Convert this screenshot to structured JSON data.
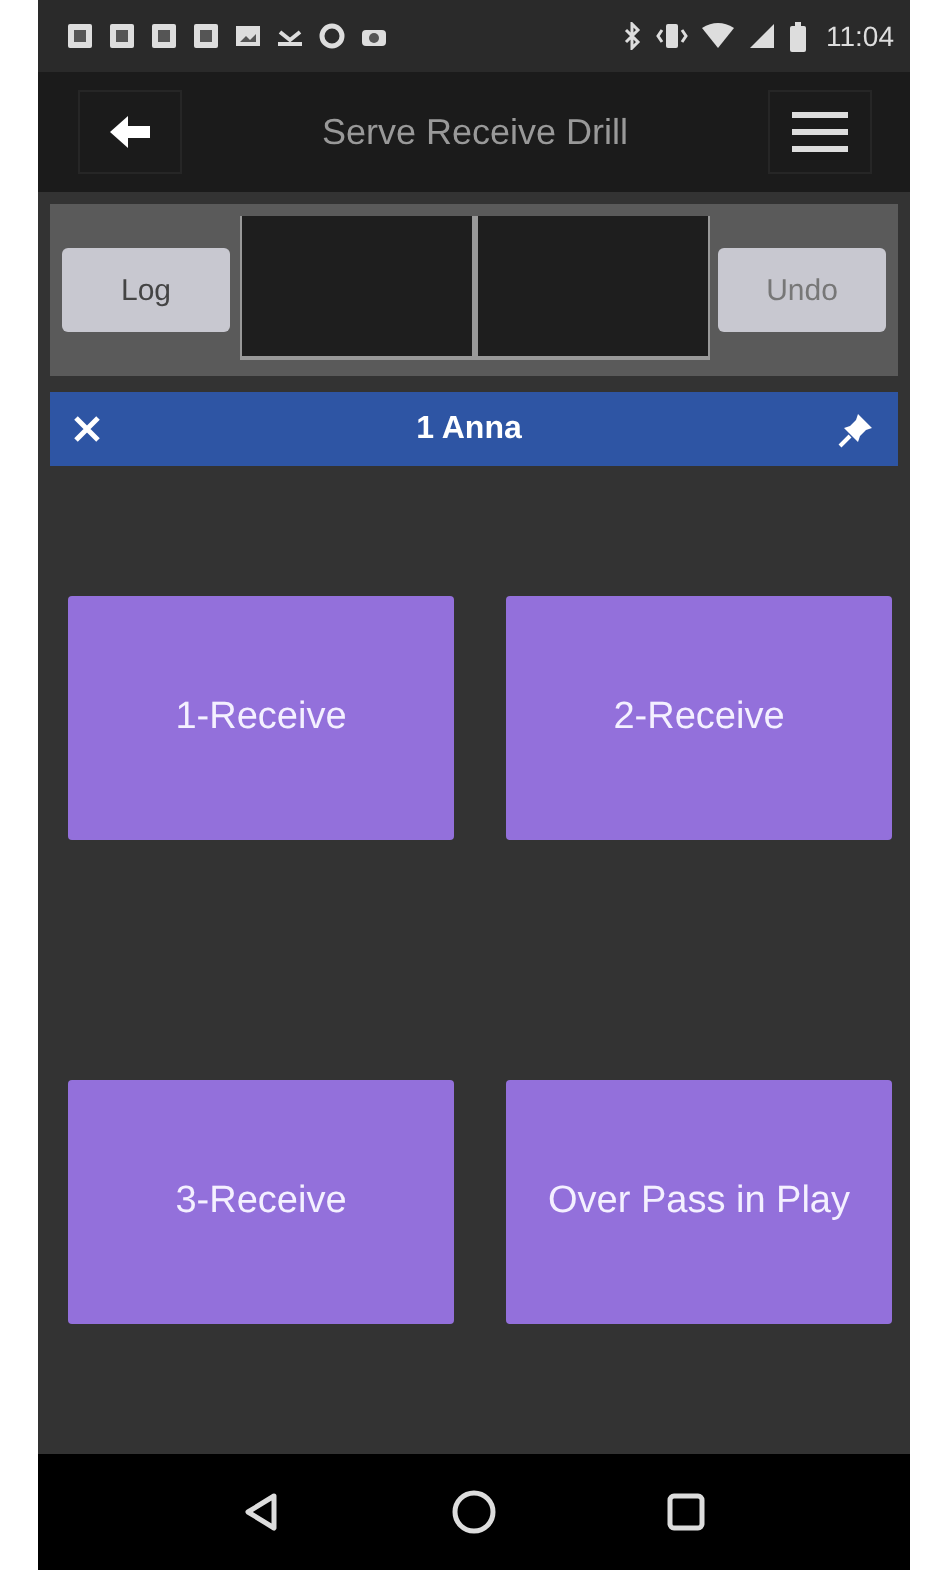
{
  "status_bar": {
    "time": "11:04"
  },
  "app_bar": {
    "title": "Serve Receive Drill"
  },
  "score_bar": {
    "buttons": [
      {
        "label": "Log"
      },
      {
        "label": "Undo"
      }
    ]
  },
  "player_bar": {
    "name": "1 Anna"
  },
  "actions": [
    {
      "label": "1-Receive"
    },
    {
      "label": "2-Receive"
    },
    {
      "label": "3-Receive"
    },
    {
      "label": "Over Pass in Play"
    }
  ]
}
